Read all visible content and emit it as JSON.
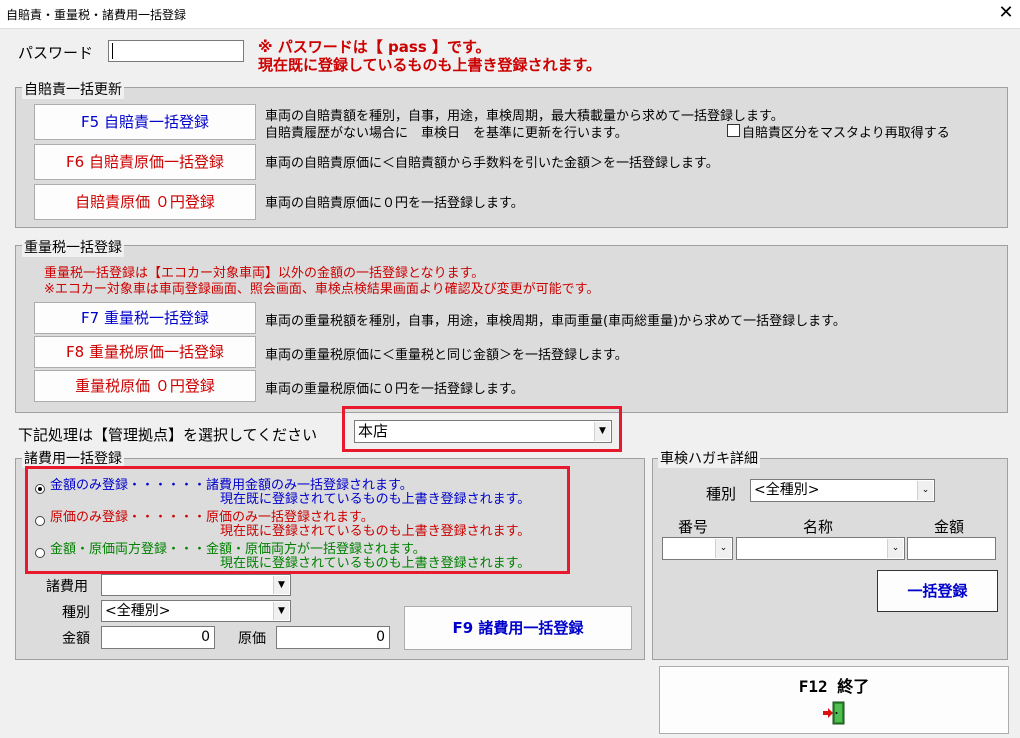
{
  "window": {
    "title": "自賠責・重量税・諸費用一括登録",
    "close": "✕"
  },
  "password": {
    "label": "パスワード",
    "value": "",
    "note1": "※ パスワードは【 pass 】です。",
    "note2": "現在既に登録しているものも上書き登録されます。"
  },
  "jibaiseki": {
    "legend": "自賠責一括更新",
    "buttons": [
      {
        "label": "F5 自賠責一括登録",
        "desc": "車両の自賠責額を種別，自事，用途，車検周期，最大積載量から求めて一括登録します。"
      },
      {
        "label": "F6 自賠責原価一括登録",
        "desc": "車両の自賠責原価に＜自賠責額から手数料を引いた金額＞を一括登録します。"
      },
      {
        "label": "自賠責原価 ０円登録",
        "desc": "車両の自賠責原価に０円を一括登録します。"
      }
    ],
    "desc_line2": "自賠責履歴がない場合に　車検日　を基準に更新を行います。",
    "checkbox_label": "自賠責区分をマスタより再取得する"
  },
  "juryozei": {
    "legend": "重量税一括登録",
    "notice1": "重量税一括登録は【エコカー対象車両】以外の金額の一括登録となります。",
    "notice2": "※エコカー対象車は車両登録画面、照会画面、車検点検結果画面より確認及び変更が可能です。",
    "buttons": [
      {
        "label": "F7 重量税一括登録",
        "desc": "車両の重量税額を種別，自事，用途，車検周期，車両重量(車両総重量)から求めて一括登録します。"
      },
      {
        "label": "F8 重量税原価一括登録",
        "desc": "車両の重量税原価に＜重量税と同じ金額＞を一括登録します。"
      },
      {
        "label": "重量税原価 ０円登録",
        "desc": "車両の重量税原価に０円を一括登録します。"
      }
    ]
  },
  "base_select": {
    "label": "下記処理は【管理拠点】を選択してください",
    "value": "本店"
  },
  "shohiyo": {
    "legend": "諸費用一括登録",
    "options": [
      {
        "label": "金額のみ登録・・・・・・諸費用金額のみ一括登録されます。",
        "sub": "現在既に登録されているものも上書き登録されます。"
      },
      {
        "label": "原価のみ登録・・・・・・原価のみ一括登録されます。",
        "sub": "現在既に登録されているものも上書き登録されます。"
      },
      {
        "label": "金額・原価両方登録・・・金額・原価両方が一括登録されます。",
        "sub": "現在既に登録されているものも上書き登録されます。"
      }
    ],
    "item_label": "諸費用",
    "item_value": "",
    "type_label": "種別",
    "type_value": "<全種別>",
    "amount_label": "金額",
    "amount_value": "0",
    "cost_label": "原価",
    "cost_value": "0",
    "submit": "F9 諸費用一括登録"
  },
  "hagaki": {
    "legend": "車検ハガキ詳細",
    "type_label": "種別",
    "type_value": "<全種別>",
    "col_number": "番号",
    "col_name": "名称",
    "col_amount": "金額",
    "submit": "一括登録"
  },
  "exit": {
    "label": "F12 終了",
    "icon": "exit-door-icon"
  }
}
